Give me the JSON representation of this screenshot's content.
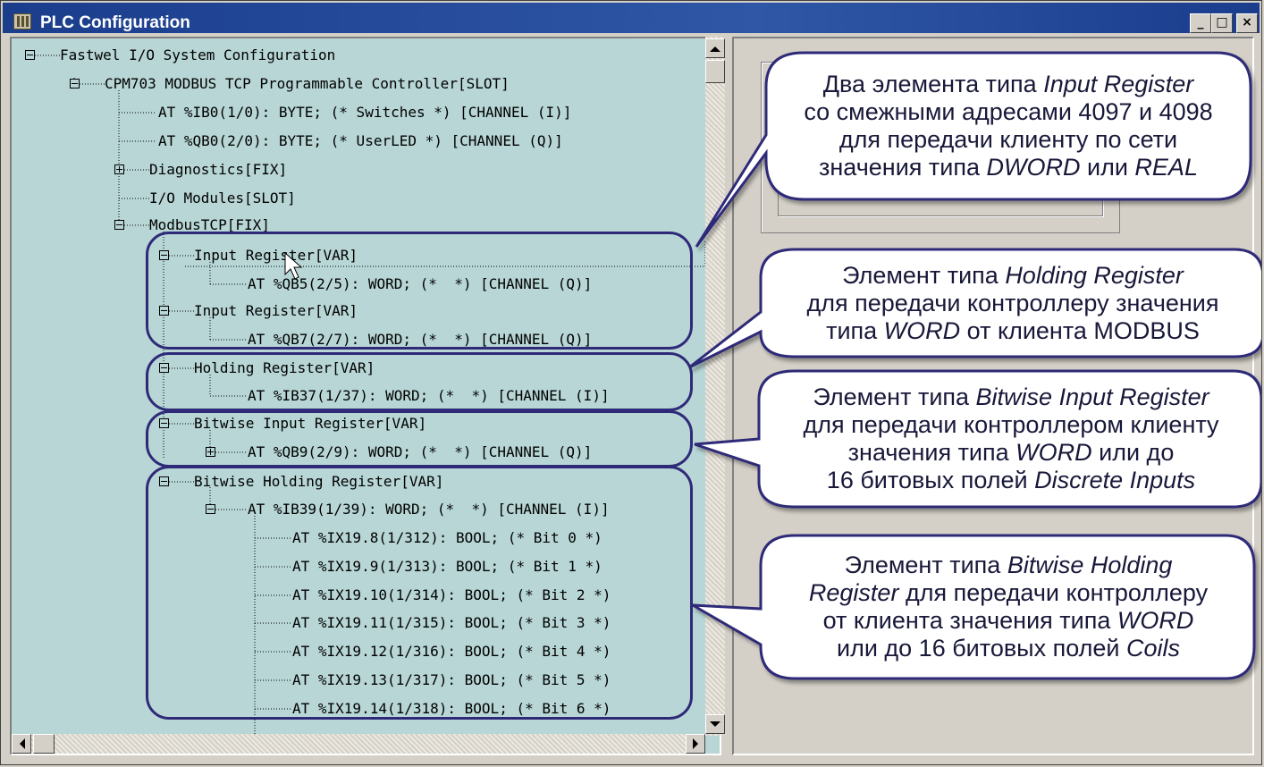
{
  "window": {
    "title": "PLC Configuration",
    "minimize": "_",
    "maximize": "□",
    "close": "×"
  },
  "tree": [
    {
      "text": "Fastwel I/O System Configuration"
    },
    {
      "text": "CPM703 MODBUS TCP Programmable Controller[SLOT]"
    },
    {
      "text": "AT %IB0(1/0): BYTE; (* Switches *) [CHANNEL (I)]"
    },
    {
      "text": "AT %QB0(2/0): BYTE; (* UserLED *) [CHANNEL (Q)]"
    },
    {
      "text": "Diagnostics[FIX]"
    },
    {
      "text": "I/O Modules[SLOT]"
    },
    {
      "text": "ModbusTCP[FIX]"
    },
    {
      "text": "Input Register[VAR]"
    },
    {
      "text": "AT %QB5(2/5): WORD; (*  *) [CHANNEL (Q)]"
    },
    {
      "text": "Input Register[VAR]"
    },
    {
      "text": "AT %QB7(2/7): WORD; (*  *) [CHANNEL (Q)]"
    },
    {
      "text": "Holding Register[VAR]"
    },
    {
      "text": "AT %IB37(1/37): WORD; (*  *) [CHANNEL (I)]"
    },
    {
      "text": "Bitwise Input Register[VAR]"
    },
    {
      "text": "AT %QB9(2/9): WORD; (*  *) [CHANNEL (Q)]"
    },
    {
      "text": "Bitwise Holding Register[VAR]"
    },
    {
      "text": "AT %IB39(1/39): WORD; (*  *) [CHANNEL (I)]"
    },
    {
      "text": "AT %IX19.8(1/312): BOOL; (* Bit 0 *)"
    },
    {
      "text": "AT %IX19.9(1/313): BOOL; (* Bit 1 *)"
    },
    {
      "text": "AT %IX19.10(1/314): BOOL; (* Bit 2 *)"
    },
    {
      "text": "AT %IX19.11(1/315): BOOL; (* Bit 3 *)"
    },
    {
      "text": "AT %IX19.12(1/316): BOOL; (* Bit 4 *)"
    },
    {
      "text": "AT %IX19.13(1/317): BOOL; (* Bit 5 *)"
    },
    {
      "text": "AT %IX19.14(1/318): BOOL; (* Bit 6 *)"
    }
  ],
  "callouts": {
    "c1": {
      "l1a": "Два элемента типа ",
      "l1b": "Input Register",
      "l2": "со смежными адресами 4097 и 4098",
      "l3": "для передачи клиенту по сети",
      "l4a": "значения типа ",
      "l4b": "DWORD",
      "l4c": " или ",
      "l4d": "REAL"
    },
    "c2": {
      "l1a": "Элемент типа ",
      "l1b": "Holding Register",
      "l2": "для передачи контроллеру значения",
      "l3a": "типа ",
      "l3b": "WORD",
      "l3c": " от клиента MODBUS"
    },
    "c3": {
      "l1a": "Элемент типа ",
      "l1b": "Bitwise Input Register",
      "l2": "для передачи контроллером клиенту",
      "l3a": "значения типа ",
      "l3b": "WORD",
      "l3c": " или до",
      "l4a": "16 битовых полей ",
      "l4b": "Discrete Inputs"
    },
    "c4": {
      "l1a": "Элемент типа ",
      "l1b": "Bitwise Holding",
      "l2a": "Register",
      "l2b": " для передачи контроллеру",
      "l3a": "от клиента значения типа ",
      "l3b": "WORD",
      "l4a": "или до 16 битовых полей ",
      "l4b": "Coils"
    }
  },
  "colors": {
    "tree_bg": "#b8d6d6",
    "title_bg": "#1a3d8c",
    "highlight": "#2e2a78"
  }
}
